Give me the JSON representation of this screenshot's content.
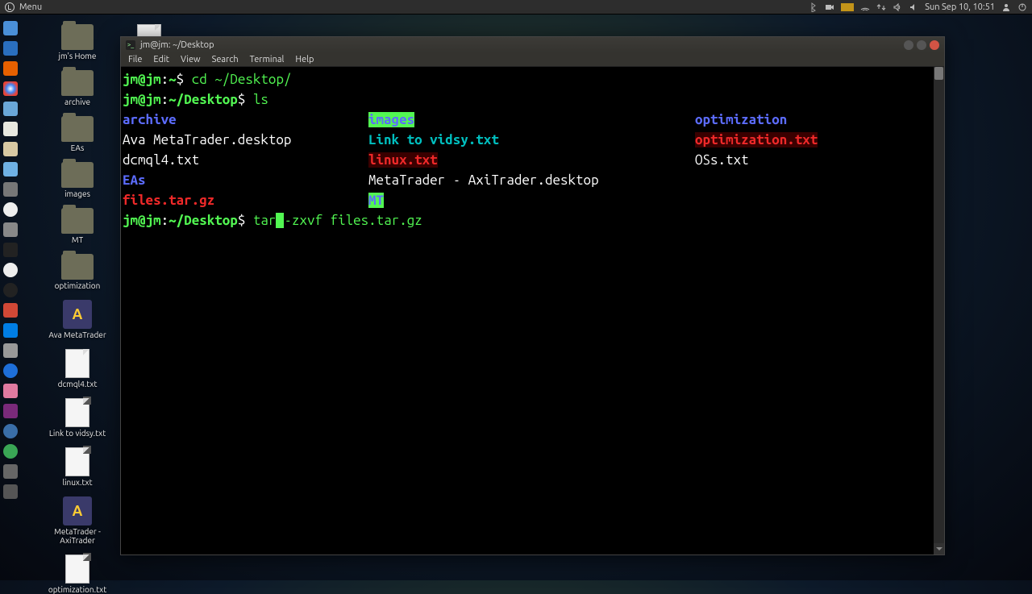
{
  "menubar": {
    "menu_label": "Menu",
    "clock": "Sun Sep 10, 10:51"
  },
  "desktop_icons": [
    {
      "kind": "folder",
      "label": "jm's Home"
    },
    {
      "kind": "folder",
      "label": "archive"
    },
    {
      "kind": "folder",
      "label": "EAs"
    },
    {
      "kind": "folder",
      "label": "images"
    },
    {
      "kind": "folder",
      "label": "MT"
    },
    {
      "kind": "folder",
      "label": "optimization"
    },
    {
      "kind": "app",
      "label": "Ava MetaTrader",
      "glyph": "A"
    },
    {
      "kind": "file",
      "label": "dcmql4.txt"
    },
    {
      "kind": "file-link",
      "label": "Link to vidsy.txt"
    },
    {
      "kind": "file-link",
      "label": "linux.txt"
    },
    {
      "kind": "app",
      "label": "MetaTrader - AxiTrader",
      "glyph": "A"
    },
    {
      "kind": "file-link",
      "label": "optimization.txt"
    }
  ],
  "dock_icons": [
    "files",
    "firefox",
    "chrome",
    "web",
    "gedit",
    "writer",
    "chrome2",
    "steam",
    "clock",
    "drag",
    "term",
    "update",
    "valve",
    "gmail",
    "dropbox",
    "chat",
    "play",
    "paint",
    "pink",
    "earth",
    "green",
    "cube",
    "app"
  ],
  "terminal": {
    "title": "jm@jm: ~/Desktop",
    "menus": [
      "File",
      "Edit",
      "View",
      "Search",
      "Terminal",
      "Help"
    ],
    "lines": {
      "p1_user": "jm@jm",
      "p1_sep": ":",
      "p1_path": "~",
      "p1_dollar": "$ ",
      "p1_cmd": "cd ~/Desktop/",
      "p2_user": "jm@jm",
      "p2_path": "~/Desktop",
      "p2_dollar": "$ ",
      "p2_cmd": "ls",
      "p3_prompt_user": "jm@jm",
      "p3_path": "~/Desktop",
      "p3_dollar": "$ ",
      "p3_cmd_pre": "tar",
      "p3_cmd_post": "-zxvf files.tar.gz"
    },
    "ls": {
      "col1": [
        {
          "cls": "c-dir",
          "txt": "archive"
        },
        {
          "cls": "c-white",
          "txt": "Ava MetaTrader.desktop"
        },
        {
          "cls": "c-white",
          "txt": "dcmql4.txt"
        },
        {
          "cls": "c-dir",
          "txt": "EAs"
        },
        {
          "cls": "c-tgz",
          "txt": "files.tar.gz"
        }
      ],
      "col2": [
        {
          "cls": "c-symlink-bg",
          "txt": "images"
        },
        {
          "cls": "c-link-file",
          "txt": "Link to vidsy.txt"
        },
        {
          "cls": "c-redfile",
          "txt": "linux.txt",
          "bg": true
        },
        {
          "cls": "c-white",
          "txt": "MetaTrader - AxiTrader.desktop"
        },
        {
          "cls": "c-symlink-bg",
          "txt": "MT"
        }
      ],
      "col3": [
        {
          "cls": "c-dir",
          "txt": "optimization"
        },
        {
          "cls": "c-redfile",
          "txt": "optimization.txt",
          "bg": true
        },
        {
          "cls": "c-white",
          "txt": "OSs.txt"
        },
        {
          "cls": "",
          "txt": ""
        },
        {
          "cls": "",
          "txt": ""
        }
      ]
    }
  }
}
